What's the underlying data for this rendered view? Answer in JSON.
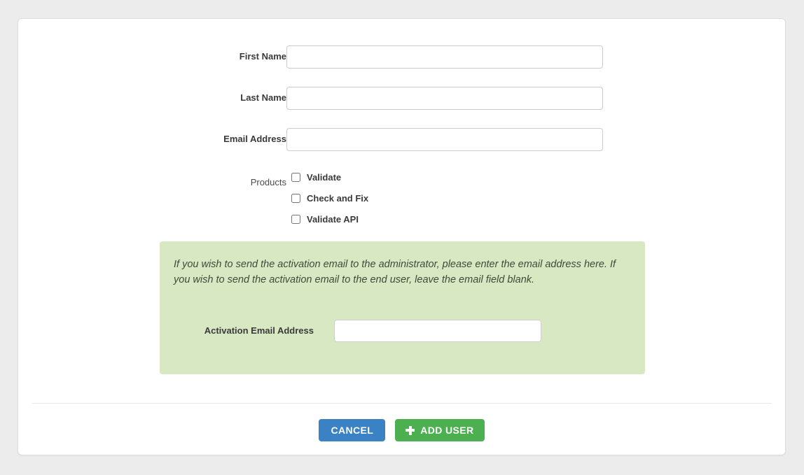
{
  "form": {
    "fields": [
      {
        "label": "First Name",
        "value": "",
        "placeholder": ""
      },
      {
        "label": "Last Name",
        "value": "",
        "placeholder": ""
      },
      {
        "label": "Email Address",
        "value": "",
        "placeholder": ""
      }
    ],
    "products": {
      "label": "Products",
      "options": [
        {
          "label": "Validate",
          "checked": false
        },
        {
          "label": "Check and Fix",
          "checked": false
        },
        {
          "label": "Validate API",
          "checked": false
        }
      ]
    },
    "notice": {
      "text": "If you wish to send the activation email to the administrator, please enter the email address here. If you wish to send the activation email to the end user, leave the email field blank.",
      "field": {
        "label": "Activation Email Address",
        "value": "",
        "placeholder": ""
      },
      "background_color": "#d7e8c3"
    }
  },
  "footer": {
    "cancel_label": "CANCEL",
    "add_user_label": "ADD USER",
    "add_user_icon": "plus-icon",
    "cancel_color": "#3b82c4",
    "add_user_color": "#4cb050"
  }
}
